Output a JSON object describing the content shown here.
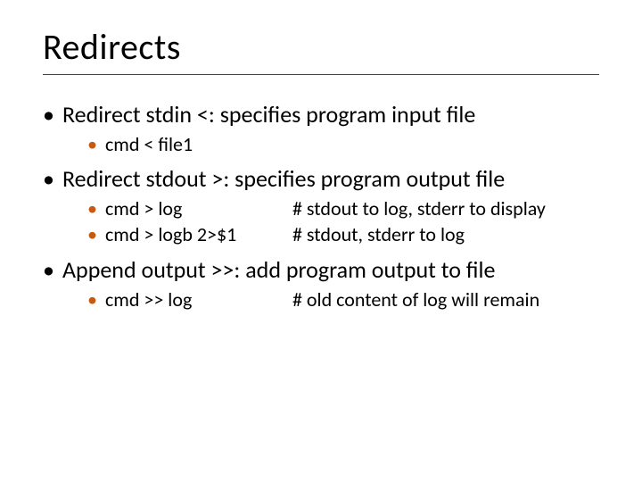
{
  "title": "Redirects",
  "items": [
    {
      "text": "Redirect stdin <: specifies program input file",
      "sub": [
        {
          "cmd": "cmd < file1",
          "comment": ""
        }
      ]
    },
    {
      "text": "Redirect stdout >: specifies program output file",
      "sub": [
        {
          "cmd": "cmd > log",
          "comment": "# stdout to log, stderr to display"
        },
        {
          "cmd": "cmd > logb 2>$1",
          "comment": "# stdout, stderr to log"
        }
      ]
    },
    {
      "text": "Append output >>: add program output to file",
      "sub": [
        {
          "cmd": "cmd >> log",
          "comment": "# old content of log will remain"
        }
      ]
    }
  ]
}
